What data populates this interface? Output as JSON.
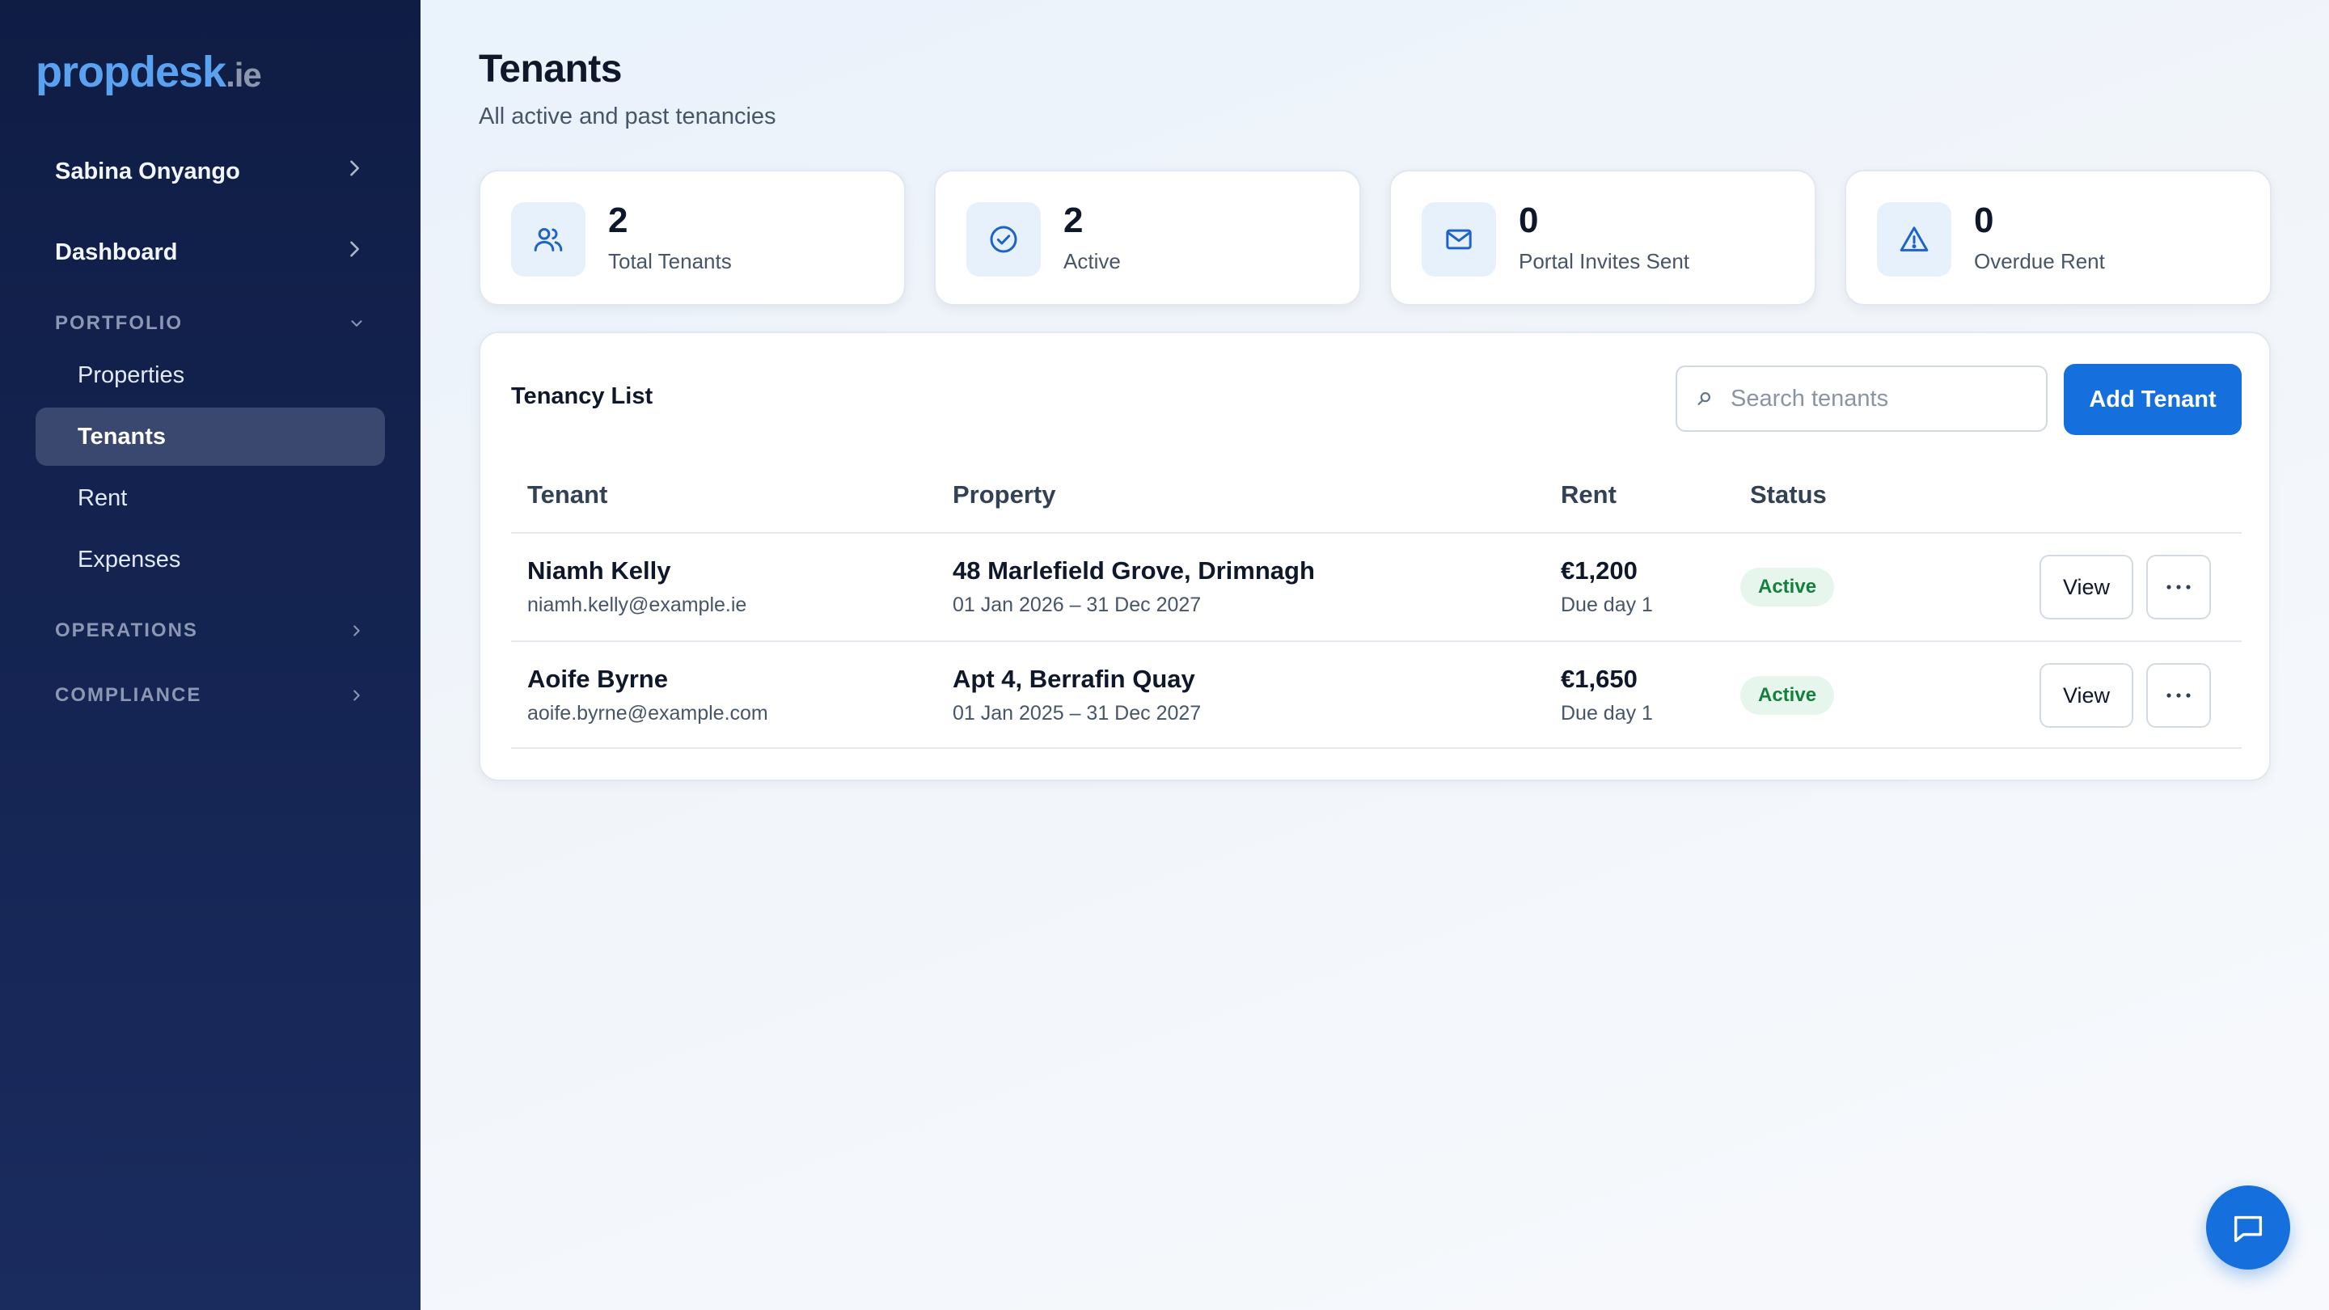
{
  "brand": {
    "name": "propdesk",
    "tld": ".ie",
    "color": "#5aa2f0"
  },
  "sidebar": {
    "user": "Sabina Onyango",
    "dashboard": "Dashboard",
    "sections": {
      "portfolio": {
        "label": "PORTFOLIO",
        "items": [
          "Properties",
          "Tenants",
          "Rent",
          "Expenses"
        ],
        "active": "Tenants"
      },
      "operations": {
        "label": "OPERATIONS"
      },
      "compliance": {
        "label": "COMPLIANCE"
      }
    }
  },
  "page": {
    "title": "Tenants",
    "subtitle": "All active and past tenancies"
  },
  "stats": [
    {
      "value": "2",
      "label": "Total Tenants",
      "icon": "users-icon"
    },
    {
      "value": "2",
      "label": "Active",
      "icon": "check-circle-icon"
    },
    {
      "value": "0",
      "label": "Portal Invites Sent",
      "icon": "mail-icon"
    },
    {
      "value": "0",
      "label": "Overdue Rent",
      "icon": "warning-triangle-icon"
    }
  ],
  "list": {
    "title": "Tenancy List",
    "search_placeholder": "Search tenants",
    "add_label": "Add Tenant",
    "columns": [
      "Tenant",
      "Property",
      "Rent",
      "Status"
    ],
    "view_label": "View",
    "rows": [
      {
        "name": "Niamh Kelly",
        "email": "niamh.kelly@example.ie",
        "property": "48 Marlefield Grove, Drimnagh",
        "period": "01 Jan 2026 – 31 Dec 2027",
        "rent": "€1,200",
        "due": "Due day 1",
        "status": "Active"
      },
      {
        "name": "Aoife Byrne",
        "email": "aoife.byrne@example.com",
        "property": "Apt 4, Berrafin Quay",
        "period": "01 Jan 2025 – 31 Dec 2027",
        "rent": "€1,650",
        "due": "Due day 1",
        "status": "Active"
      }
    ]
  },
  "colors": {
    "accent": "#1570dd",
    "sidebar_bg": "#0f1d45",
    "active_badge_bg": "#e7f6ec",
    "active_badge_text": "#15803d"
  }
}
